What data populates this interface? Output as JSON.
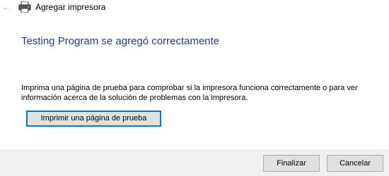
{
  "window": {
    "title": "Agregar impresora",
    "back_icon": "back-arrow-icon",
    "title_icon": "printer-icon"
  },
  "main": {
    "heading": "Testing Program se agregó correctamente",
    "description": "Imprima una página de prueba para comprobar si la impresora funciona correctamente o para ver información acerca de la solución de problemas con la impresora.",
    "test_button_label": "Imprimir una página de prueba"
  },
  "footer": {
    "finish_label": "Finalizar",
    "cancel_label": "Cancelar"
  },
  "colors": {
    "heading": "#1e3c8c",
    "focus_border": "#0078d7",
    "footer_bg": "#f0f0f0",
    "button_bg": "#e1e1e1"
  }
}
